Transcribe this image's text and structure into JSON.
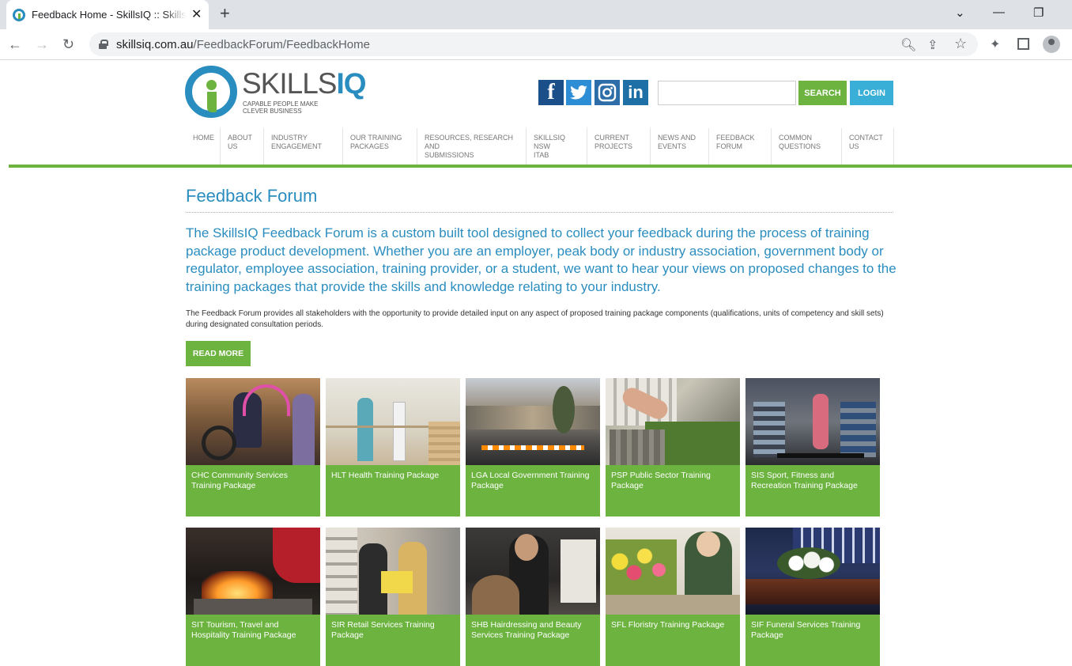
{
  "browser": {
    "tab_title": "Feedback Home - SkillsIQ :: SkillsIQ",
    "tab_close": "✕",
    "new_tab": "+",
    "url_host": "skillsiq.com.au",
    "url_path": "/FeedbackForum/FeedbackHome",
    "window_controls": [
      "⌄",
      "—",
      "❐"
    ]
  },
  "header": {
    "logo_text_skills": "SKILLS",
    "logo_text_iq": "IQ",
    "logo_tagline_1": "CAPABLE PEOPLE MAKE",
    "logo_tagline_2": "CLEVER BUSINESS",
    "social": [
      "f",
      "t",
      "ig",
      "in"
    ],
    "search_placeholder": "",
    "search_label": "SEARCH",
    "login_label": "LOGIN"
  },
  "nav": [
    {
      "l1": "HOME",
      "l2": ""
    },
    {
      "l1": "ABOUT",
      "l2": "US"
    },
    {
      "l1": "INDUSTRY",
      "l2": "ENGAGEMENT"
    },
    {
      "l1": "OUR TRAINING",
      "l2": "PACKAGES"
    },
    {
      "l1": "RESOURCES, RESEARCH AND",
      "l2": "SUBMISSIONS"
    },
    {
      "l1": "SKILLSIQ NSW",
      "l2": "ITAB"
    },
    {
      "l1": "CURRENT",
      "l2": "PROJECTS"
    },
    {
      "l1": "NEWS AND",
      "l2": "EVENTS"
    },
    {
      "l1": "FEEDBACK",
      "l2": "FORUM"
    },
    {
      "l1": "COMMON",
      "l2": "QUESTIONS"
    },
    {
      "l1": "CONTACT",
      "l2": "US"
    }
  ],
  "main": {
    "title": "Feedback Forum",
    "lead": "The SkillsIQ Feedback Forum is a custom built tool designed to collect your feedback during the process of training package product development. Whether you are an employer, peak body or industry association, government body or regulator, employee association, training provider, or a student, we want to hear your views on proposed changes to the training packages that provide the skills and knowledge relating to your industry.",
    "body": "The Feedback Forum provides all stakeholders with the opportunity to provide detailed input on any aspect of proposed training package components (qualifications, units of competency and skill sets) during designated consultation periods.",
    "read_more": "READ MORE"
  },
  "cards": [
    {
      "caption": "CHC Community Services Training Package"
    },
    {
      "caption": "HLT Health Training Package"
    },
    {
      "caption": "LGA Local Government Training Package"
    },
    {
      "caption": "PSP Public Sector Training Package"
    },
    {
      "caption": "SIS Sport, Fitness and Recreation Training Package"
    },
    {
      "caption": "SIT Tourism, Travel and Hospitality Training Package"
    },
    {
      "caption": "SIR Retail Services Training Package"
    },
    {
      "caption": "SHB Hairdressing and Beauty Services Training Package"
    },
    {
      "caption": "SFL Floristry Training Package"
    },
    {
      "caption": "SIF Funeral Services Training Package"
    }
  ],
  "colors": {
    "brand_blue": "#2a8dbf",
    "brand_green": "#6cb33f",
    "login_blue": "#39afd8"
  }
}
